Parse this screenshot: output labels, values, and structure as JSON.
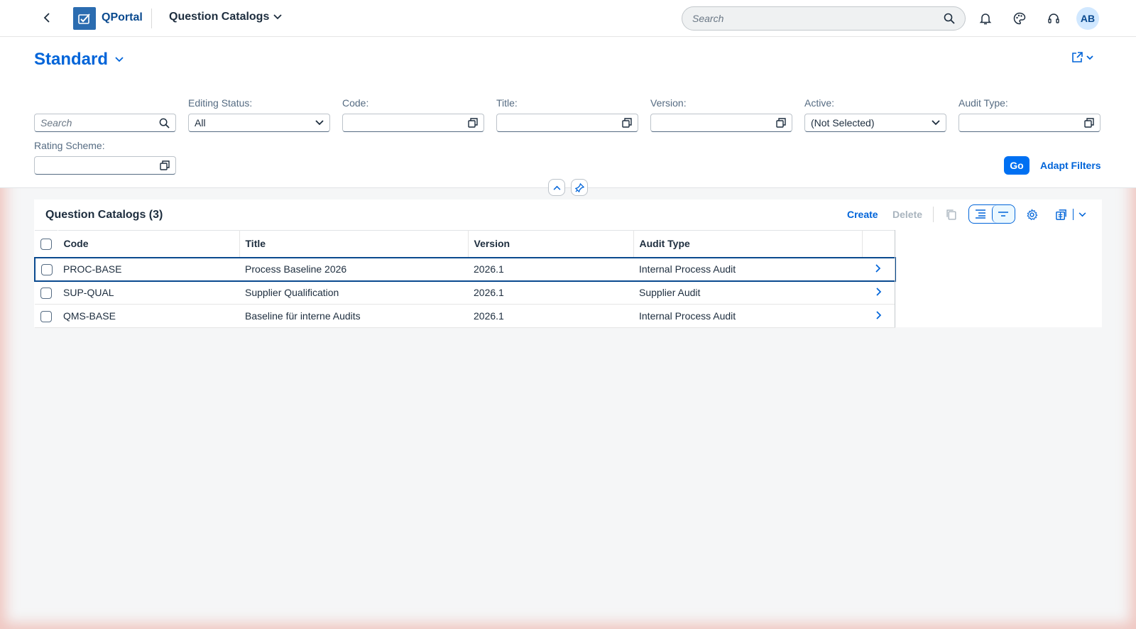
{
  "shell": {
    "brand": "QPortal",
    "app_title": "Question Catalogs",
    "search_placeholder": "Search",
    "avatar_initials": "AB"
  },
  "header": {
    "variant": "Standard"
  },
  "filters": {
    "search_placeholder": "Search",
    "editing_status": {
      "label": "Editing Status:",
      "value": "All"
    },
    "code": {
      "label": "Code:",
      "value": ""
    },
    "title": {
      "label": "Title:",
      "value": ""
    },
    "version": {
      "label": "Version:",
      "value": ""
    },
    "active": {
      "label": "Active:",
      "value": "(Not Selected)"
    },
    "audit_type": {
      "label": "Audit Type:",
      "value": ""
    },
    "rating_scheme": {
      "label": "Rating Scheme:",
      "value": ""
    },
    "go_label": "Go",
    "adapt_label": "Adapt Filters"
  },
  "table": {
    "title": "Question Catalogs (3)",
    "create_label": "Create",
    "delete_label": "Delete",
    "columns": [
      "Code",
      "Title",
      "Version",
      "Audit Type"
    ],
    "rows": [
      {
        "code": "PROC-BASE",
        "title": "Process Baseline 2026",
        "version": "2026.1",
        "audit_type": "Internal Process Audit"
      },
      {
        "code": "SUP-QUAL",
        "title": "Supplier Qualification",
        "version": "2026.1",
        "audit_type": "Supplier Audit"
      },
      {
        "code": "QMS-BASE",
        "title": "Baseline für interne Audits",
        "version": "2026.1",
        "audit_type": "Internal Process Audit"
      }
    ]
  },
  "colors": {
    "accent": "#0064d9",
    "button_emphasized": "#0070f2",
    "disabled_text": "#a9b4be"
  }
}
